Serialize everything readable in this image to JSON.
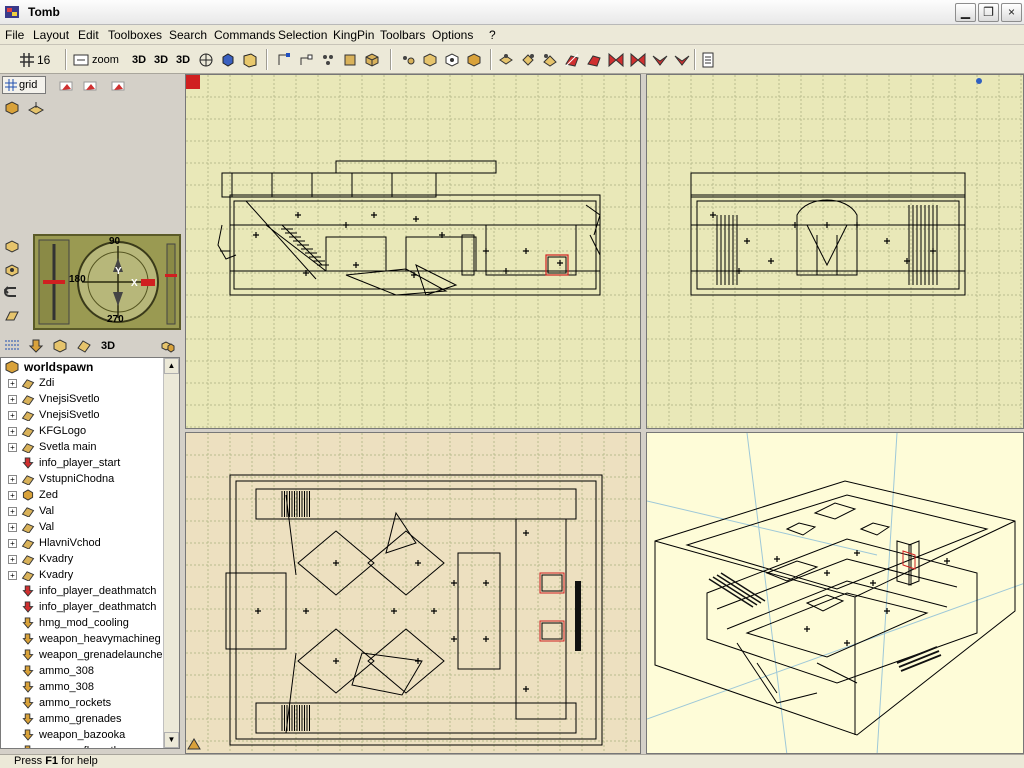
{
  "window": {
    "title": "Tomb",
    "minimize": "0",
    "maximize": "1",
    "close": "×"
  },
  "menu": [
    "File",
    "Layout",
    "Edit",
    "Toolboxes",
    "Search",
    "Commands",
    "Selection",
    "KingPin",
    "Toolbars",
    "Options",
    "?"
  ],
  "toolbar": {
    "grid_size": "16",
    "zoom_label": "zoom",
    "view_3d_a": "3D",
    "view_3d_b": "3D",
    "view_3d_c": "3D"
  },
  "left_panel": {
    "grid_label": "grid",
    "view_3d_label": "3D"
  },
  "compass": {
    "north": "90",
    "west": "180",
    "south": "270",
    "y_axis": "Y",
    "x_axis": "X"
  },
  "tree": {
    "root": "worldspawn",
    "items": [
      {
        "label": "Zdi",
        "type": "brush",
        "expand": true
      },
      {
        "label": "VnejsiSvetlo",
        "type": "brush",
        "expand": true
      },
      {
        "label": "VnejsiSvetlo",
        "type": "brush",
        "expand": true
      },
      {
        "label": "KFGLogo",
        "type": "brush",
        "expand": true
      },
      {
        "label": "Svetla main",
        "type": "brush",
        "expand": true
      },
      {
        "label": "info_player_start",
        "type": "entity-red",
        "expand": false
      },
      {
        "label": "VstupniChodna",
        "type": "brush",
        "expand": true
      },
      {
        "label": "Zed",
        "type": "cube",
        "expand": true
      },
      {
        "label": "Val",
        "type": "brush",
        "expand": true
      },
      {
        "label": "Val",
        "type": "brush",
        "expand": true
      },
      {
        "label": "HlavniVchod",
        "type": "brush",
        "expand": true
      },
      {
        "label": "Kvadry",
        "type": "brush",
        "expand": true
      },
      {
        "label": "Kvadry",
        "type": "brush",
        "expand": true
      },
      {
        "label": "info_player_deathmatch",
        "type": "entity-red",
        "expand": false
      },
      {
        "label": "info_player_deathmatch",
        "type": "entity-red",
        "expand": false
      },
      {
        "label": "hmg_mod_cooling",
        "type": "entity-yellow",
        "expand": false
      },
      {
        "label": "weapon_heavymachineg",
        "type": "entity-yellow",
        "expand": false
      },
      {
        "label": "weapon_grenadelaunche",
        "type": "entity-yellow",
        "expand": false
      },
      {
        "label": "ammo_308",
        "type": "entity-yellow",
        "expand": false
      },
      {
        "label": "ammo_308",
        "type": "entity-yellow",
        "expand": false
      },
      {
        "label": "ammo_rockets",
        "type": "entity-yellow",
        "expand": false
      },
      {
        "label": "ammo_grenades",
        "type": "entity-yellow",
        "expand": false
      },
      {
        "label": "weapon_bazooka",
        "type": "entity-yellow",
        "expand": false
      },
      {
        "label": "weapon_flamethrower",
        "type": "entity-yellow",
        "expand": false
      }
    ]
  },
  "status": {
    "prefix": "Press ",
    "key": "F1",
    "suffix": " for help"
  },
  "colors": {
    "grid_bg_front": "#e9e8b8",
    "grid_bg_top": "#ede0c0",
    "grid_line": "#b9bd8e",
    "wire": "#000000",
    "selection": "#d02020",
    "view3d_bg": "#fefcd8"
  }
}
